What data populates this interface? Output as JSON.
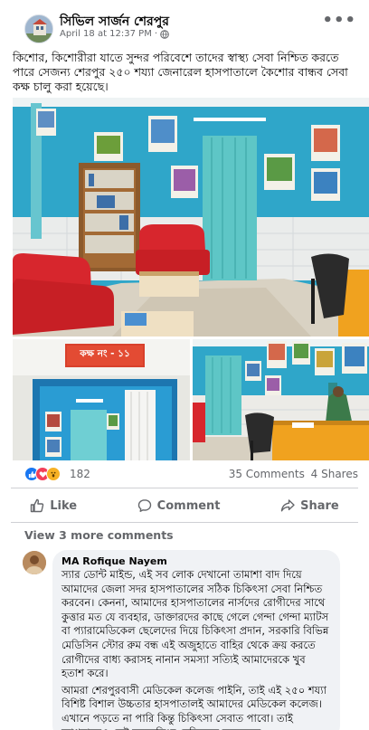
{
  "post": {
    "page_name": "সিভিল সার্জন শেরপুর",
    "date": "April 18 at 12:37 PM",
    "separator": "·",
    "more": "•••",
    "text": "কিশোর, কিশোরীরা যাতে সুন্দর পরিবেশে তাদের স্বাস্থ্য সেবা নিশ্চিত করতে পারে সেজন্য শেরপুর ২৫০ শয্যা জেনারেল হাসপাতালে কৈশোর বান্ধব সেবা কক্ষ চালু করা হয়েছে।"
  },
  "photos": {
    "room_sign": "কক্ষ নং - ১১"
  },
  "stats": {
    "reaction_count": "182",
    "comments": "35 Comments",
    "shares": "4 Shares",
    "reaction_icons": [
      "like-icon",
      "love-icon",
      "wow-icon"
    ]
  },
  "actions": {
    "like": "Like",
    "comment": "Comment",
    "share": "Share"
  },
  "comments": {
    "view_more": "View 3 more comments",
    "items": [
      {
        "author": "MA Rofique Nayem",
        "paragraph1": "স্যার ডোন্ট মাইন্ড, এই সব লোক দেখানো তামাশা বাদ দিয়ে আমাদের জেলা সদর হাসপাতালের সঠিক চিকিৎসা সেবা নিশ্চিত করবেন। কেননা, আমাদের হাসপাতালের নার্সদের রোগীদের সাথে কুত্তার মত যে ব্যবহার, ডাক্তারদের কাছে গেলে গেন্দা গেন্দা ম্যাটস বা প্যারামেডিকেল ছেলেদের দিয়ে চিকিৎসা প্রদান, সরকারি বিভিন্ন মেডিসিন স্টোর রুম বন্ধ এই অজুহাতে বাহির থেকে ক্রয় করতে রোগীদের বাধ্য করাসহ নানান সমস্যা সত্যিই আমাদেরকে খুব হতাশ করে।",
        "paragraph2": "আমরা শেরপুরবাসী মেডিকেল কলেজ পাইনি, তাই এই ২৫০ শয্যা বিশিষ্ট বিশাল উচ্চতার হাসপাতালই আমাদের মেডিকেল কলেজ। এখানে পড়তে না পারি কিন্তু চিকিৎসা সেবাত পাবো। তাই আপনাকেও সেই ময়মনসিংহ মেডিকেল কলেজের"
      }
    ]
  },
  "colors": {
    "facebook_blue": "#1877f2",
    "wall_teal": "#2fa6c9",
    "sofa_red": "#d7262d",
    "curtain_teal": "#5ec6c6"
  }
}
